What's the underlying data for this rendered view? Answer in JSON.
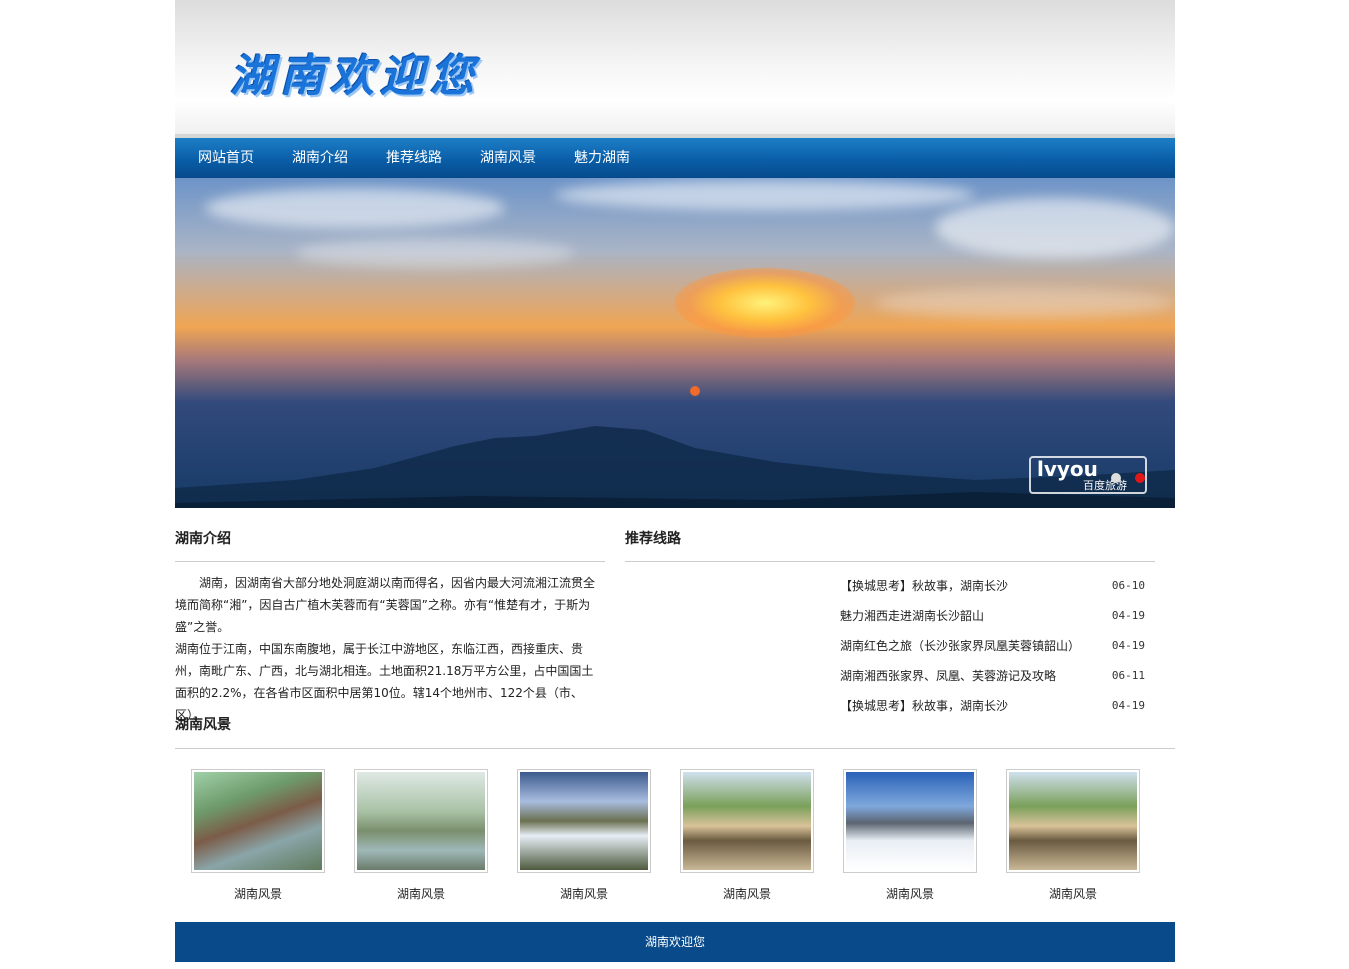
{
  "header": {
    "logo_text": "湖南欢迎您"
  },
  "nav": {
    "items": [
      {
        "label": "网站首页"
      },
      {
        "label": "湖南介绍"
      },
      {
        "label": "推荐线路"
      },
      {
        "label": "湖南风景"
      },
      {
        "label": "魅力湖南"
      }
    ]
  },
  "banner": {
    "watermark_main": "lvyou",
    "watermark_sub": "百度旅游",
    "slide_count": 2,
    "active_slide": 2
  },
  "intro": {
    "title": "湖南介绍",
    "paragraph1": "湖南，因湖南省大部分地处洞庭湖以南而得名，因省内最大河流湘江流贯全境而简称“湘”，因自古广植木芙蓉而有“芙蓉国”之称。亦有“惟楚有才，于斯为盛”之誉。",
    "paragraph2": "湖南位于江南，中国东南腹地，属于长江中游地区，东临江西，西接重庆、贵州，南毗广东、广西，北与湖北相连。土地面积21.18万平方公里，占中国国土面积的2.2%，在各省市区面积中居第10位。辖14个地州市、122个县（市、区）。"
  },
  "routes": {
    "title": "推荐线路",
    "items": [
      {
        "title": "【换城思考】秋故事，湖南长沙",
        "date": "06-10"
      },
      {
        "title": "魅力湘西走进湖南长沙韶山",
        "date": "04-19"
      },
      {
        "title": "湖南红色之旅（长沙张家界凤凰芙蓉镇韶山）",
        "date": "04-19"
      },
      {
        "title": "湖南湘西张家界、凤凰、芙蓉游记及攻略",
        "date": "06-11"
      },
      {
        "title": "【换城思考】秋故事，湖南长沙",
        "date": "04-19"
      }
    ]
  },
  "scenery": {
    "title": "湖南风景",
    "items": [
      {
        "caption": "湖南风景"
      },
      {
        "caption": "湖南风景"
      },
      {
        "caption": "湖南风景"
      },
      {
        "caption": "湖南风景"
      },
      {
        "caption": "湖南风景"
      },
      {
        "caption": "湖南风景"
      }
    ]
  },
  "footer": {
    "text": "湖南欢迎您"
  },
  "colors": {
    "nav_blue": "#0a5ea8",
    "footer_blue": "#084a8a",
    "logo_blue": "#1a73d8",
    "active_dot": "#e01818"
  }
}
